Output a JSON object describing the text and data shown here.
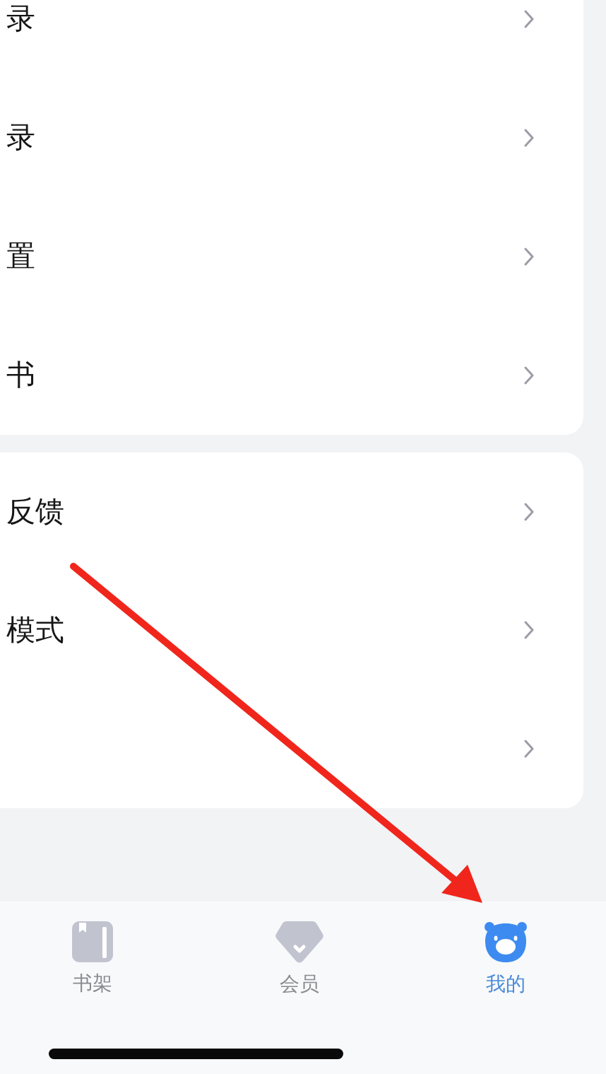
{
  "menu_groups": [
    {
      "rows": [
        {
          "kind": "link",
          "label": "录"
        },
        {
          "kind": "link",
          "label": "录"
        },
        {
          "kind": "link",
          "label": "置"
        },
        {
          "kind": "link",
          "label": "书"
        }
      ]
    },
    {
      "rows": [
        {
          "kind": "link",
          "label": "反馈"
        },
        {
          "kind": "link",
          "label": "模式"
        },
        {
          "kind": "link"
        }
      ]
    }
  ],
  "tab_bar": {
    "tabs": [
      {
        "label": "书架",
        "selected": false
      },
      {
        "label": "会员",
        "selected": false
      },
      {
        "label": "我的",
        "selected": true
      }
    ]
  },
  "annotation": {
    "kind": "arrow"
  }
}
